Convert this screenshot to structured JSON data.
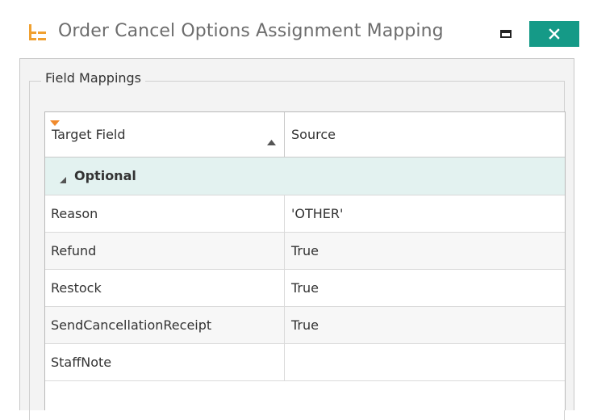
{
  "window": {
    "title": "Order Cancel Options Assignment Mapping",
    "accent_color": "#159a87",
    "app_icon": "tree-list-icon"
  },
  "groupbox": {
    "legend": "Field Mappings"
  },
  "grid": {
    "columns": [
      {
        "label": "Target Field",
        "sort": "ascending",
        "has_filter": true
      },
      {
        "label": "Source"
      }
    ],
    "group": {
      "label": "Optional",
      "expanded": true,
      "background": "#e3f2f0"
    },
    "rows": [
      {
        "target": "Reason",
        "source": "'OTHER'"
      },
      {
        "target": "Refund",
        "source": "True"
      },
      {
        "target": "Restock",
        "source": "True"
      },
      {
        "target": "SendCancellationReceipt",
        "source": "True"
      },
      {
        "target": "StaffNote",
        "source": ""
      }
    ]
  }
}
